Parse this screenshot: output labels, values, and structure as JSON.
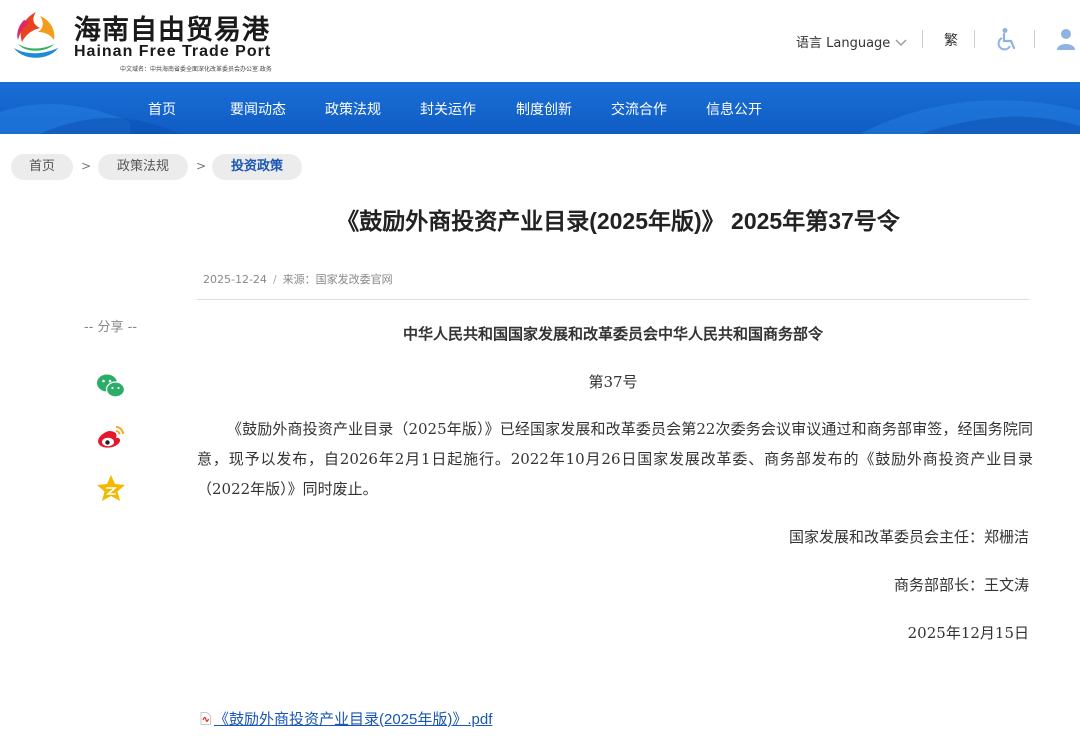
{
  "header": {
    "logo_cn": "海南自由贸易港",
    "logo_en": "Hainan Free Trade Port",
    "logo_sub": "中文域名：中共海南省委全面深化改革委员会办公室.政务",
    "language_label": "语言 Language",
    "traditional_label": "繁"
  },
  "nav": {
    "items": [
      "首页",
      "要闻动态",
      "政策法规",
      "封关运作",
      "制度创新",
      "交流合作",
      "信息公开"
    ]
  },
  "breadcrumb": {
    "items": [
      "首页",
      "政策法规",
      "投资政策"
    ],
    "separator": ">"
  },
  "article": {
    "title": "《鼓励外商投资产业目录(2025年版)》 2025年第37号令",
    "date": "2025-12-24",
    "source": "来源：国家发改委官网",
    "order_title": "中华人民共和国国家发展和改革委员会中华人民共和国商务部令",
    "order_no": "第37号",
    "paragraph": "《鼓励外商投资产业目录（2025年版）》已经国家发展和改革委员会第22次委务会议审议通过和商务部审签，经国务院同意，现予以发布，自2026年2月1日起施行。2022年10月26日国家发展改革委、商务部发布的《鼓励外商投资产业目录（2022年版）》同时废止。",
    "sign_1": "国家发展和改革委员会主任：郑栅洁",
    "sign_2": "商务部部长：王文涛",
    "sign_date": "2025年12月15日",
    "attachment": "《鼓励外商投资产业目录(2025年版)》.pdf"
  },
  "share": {
    "label": "-- 分享 --",
    "icons": [
      "wechat-icon",
      "weibo-icon",
      "favorite-star-icon"
    ]
  },
  "colors": {
    "nav_blue": "#1466cf",
    "link_blue": "#1a56b3",
    "wechat_green": "#2aae67",
    "weibo_red": "#e6162d",
    "star_gold": "#f5b800"
  }
}
